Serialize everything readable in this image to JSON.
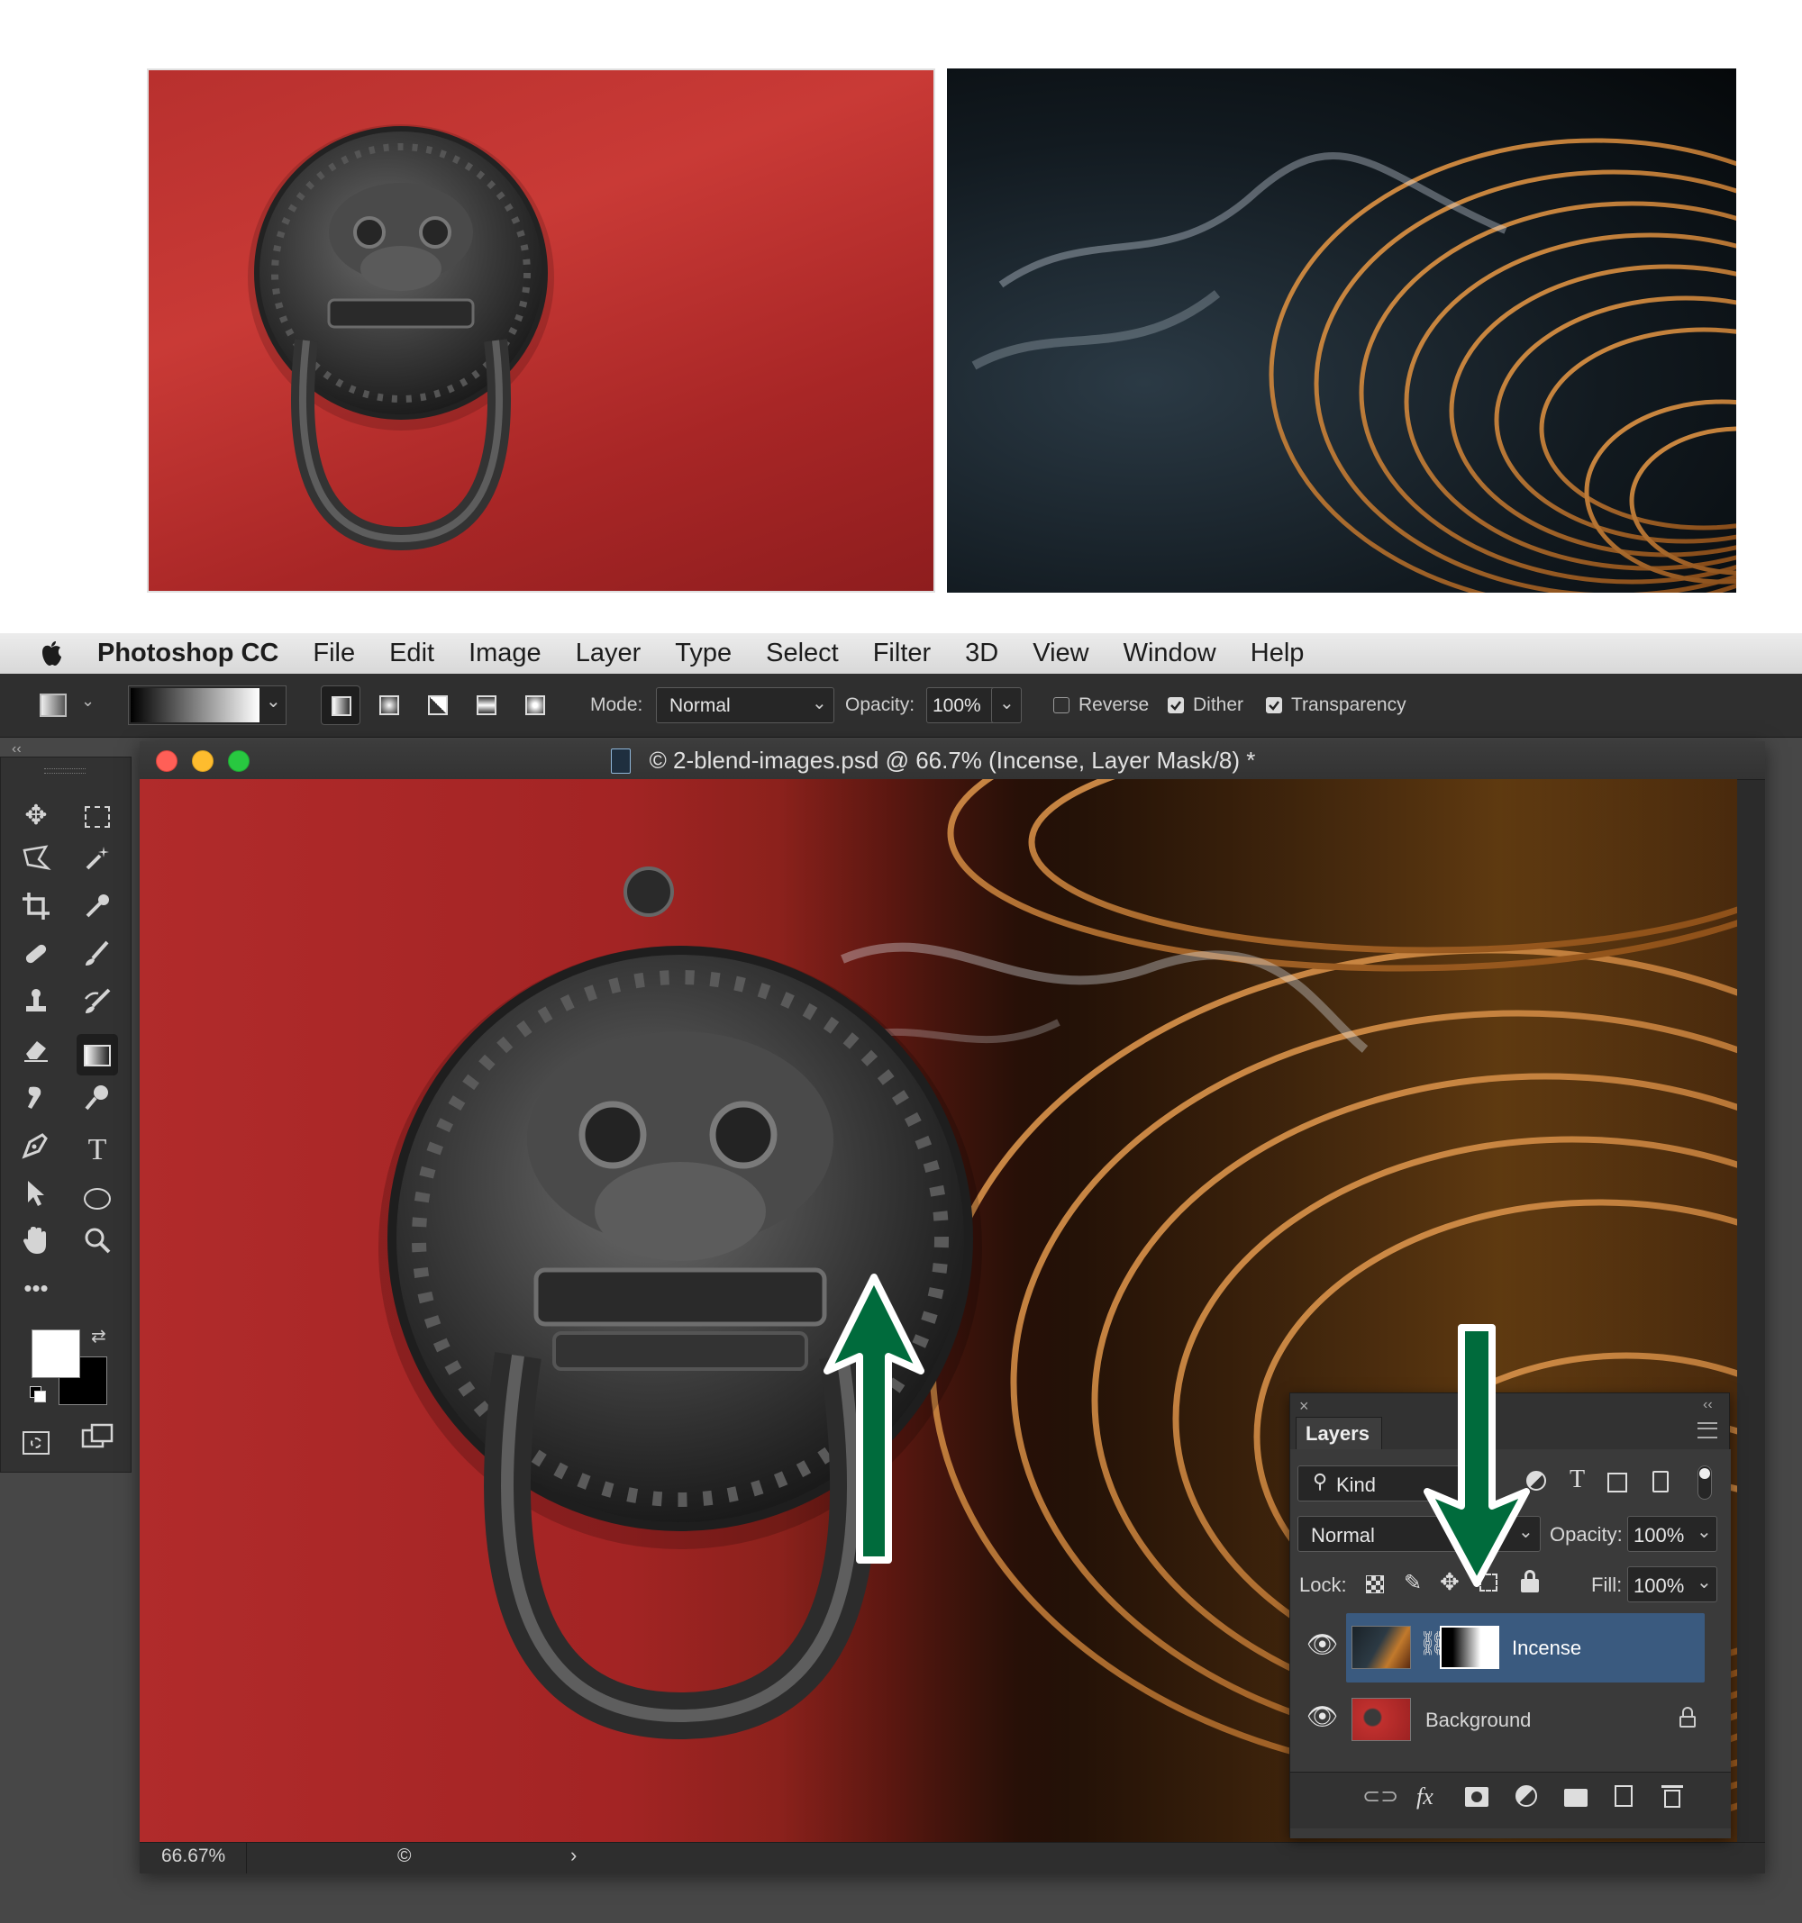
{
  "menubar": {
    "app_name": "Photoshop CC",
    "items": [
      "File",
      "Edit",
      "Image",
      "Layer",
      "Type",
      "Select",
      "Filter",
      "3D",
      "View",
      "Window",
      "Help"
    ]
  },
  "options": {
    "mode_label": "Mode:",
    "mode_value": "Normal",
    "opacity_label": "Opacity:",
    "opacity_value": "100%",
    "reverse_label": "Reverse",
    "reverse_checked": false,
    "dither_label": "Dither",
    "dither_checked": true,
    "transparency_label": "Transparency",
    "transparency_checked": true
  },
  "document": {
    "title": "© 2-blend-images.psd @ 66.7% (Incense, Layer Mask/8) *",
    "zoom": "66.67%",
    "status_symbol": "©"
  },
  "layers_panel": {
    "tab_label": "Layers",
    "filter_label": "Kind",
    "blend_mode": "Normal",
    "opacity_label": "Opacity:",
    "opacity_value": "100%",
    "lock_label": "Lock:",
    "fill_label": "Fill:",
    "fill_value": "100%",
    "layers": [
      {
        "name": "Incense",
        "selected": true,
        "visible": true,
        "has_mask": true
      },
      {
        "name": "Background",
        "selected": false,
        "visible": true,
        "locked": true
      }
    ]
  },
  "icons": {
    "apple": "apple-logo-icon",
    "move": "move-icon",
    "marquee": "rectangular-marquee-icon",
    "lasso": "polygonal-lasso-icon",
    "magic_wand": "magic-wand-icon",
    "crop": "crop-icon",
    "eyedropper": "eyedropper-icon",
    "healing": "healing-brush-icon",
    "brush": "brush-icon",
    "stamp": "clone-stamp-icon",
    "history_brush": "history-brush-icon",
    "eraser": "eraser-icon",
    "gradient": "gradient-icon",
    "smudge": "smudge-icon",
    "dodge": "dodge-icon",
    "pen": "pen-icon",
    "type": "type-icon",
    "path_select": "path-selection-icon",
    "ellipse": "ellipse-icon",
    "hand": "hand-icon",
    "zoom": "zoom-icon"
  },
  "colors": {
    "arrow_green": "#006b3c",
    "selected_layer": "#3a5a7f",
    "menu_bg": "#e3e3e3",
    "panel_bg": "#323232"
  }
}
